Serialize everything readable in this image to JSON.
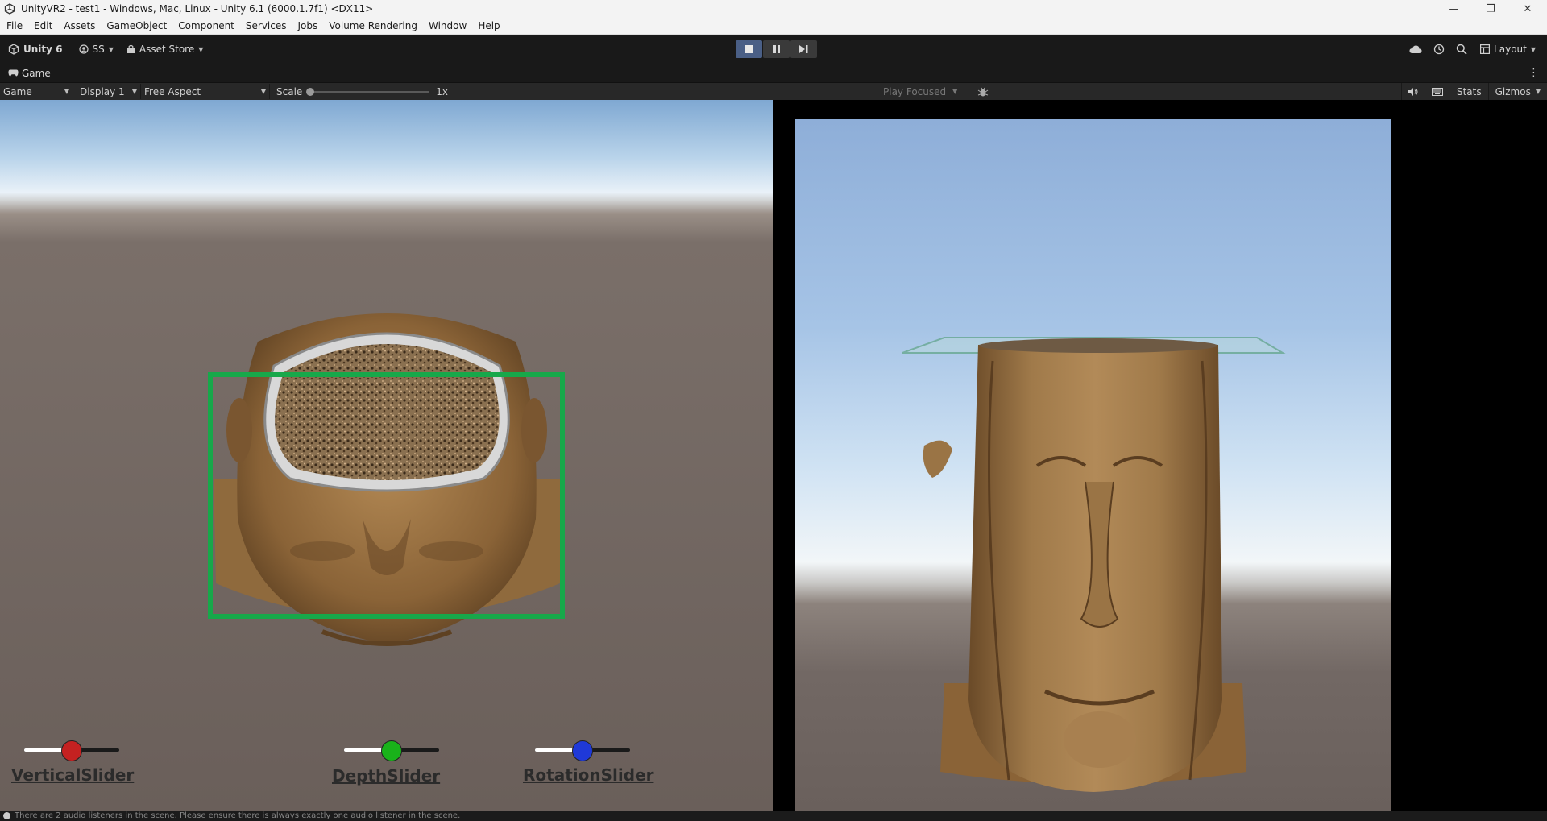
{
  "window": {
    "title": "UnityVR2 - test1 - Windows, Mac, Linux - Unity 6.1 (6000.1.7f1) <DX11>"
  },
  "menu": [
    "File",
    "Edit",
    "Assets",
    "GameObject",
    "Component",
    "Services",
    "Jobs",
    "Volume Rendering",
    "Window",
    "Help"
  ],
  "toolbar": {
    "unity_label": "Unity 6",
    "account_label": "SS",
    "asset_store_label": "Asset Store",
    "layout_label": "Layout"
  },
  "tab": {
    "label": "Game"
  },
  "gamebar": {
    "mode": "Game",
    "display": "Display 1",
    "aspect": "Free Aspect",
    "scale_label": "Scale",
    "scale_value": "1x",
    "play_focused": "Play Focused",
    "stats": "Stats",
    "gizmos": "Gizmos"
  },
  "sliders": [
    {
      "label": "VerticalSlider",
      "color": "#c42121",
      "value": 0.5
    },
    {
      "label": "DepthSlider",
      "color": "#19b21a",
      "value": 0.5
    },
    {
      "label": "RotationSlider",
      "color": "#1f39d8",
      "value": 0.5
    }
  ],
  "status": {
    "text": "There are 2 audio listeners in the scene. Please ensure there is always exactly one audio listener in the scene."
  },
  "colors": {
    "selection_box": "#17a84a",
    "play_active": "#4a5f86",
    "skin": "#9a7445"
  }
}
